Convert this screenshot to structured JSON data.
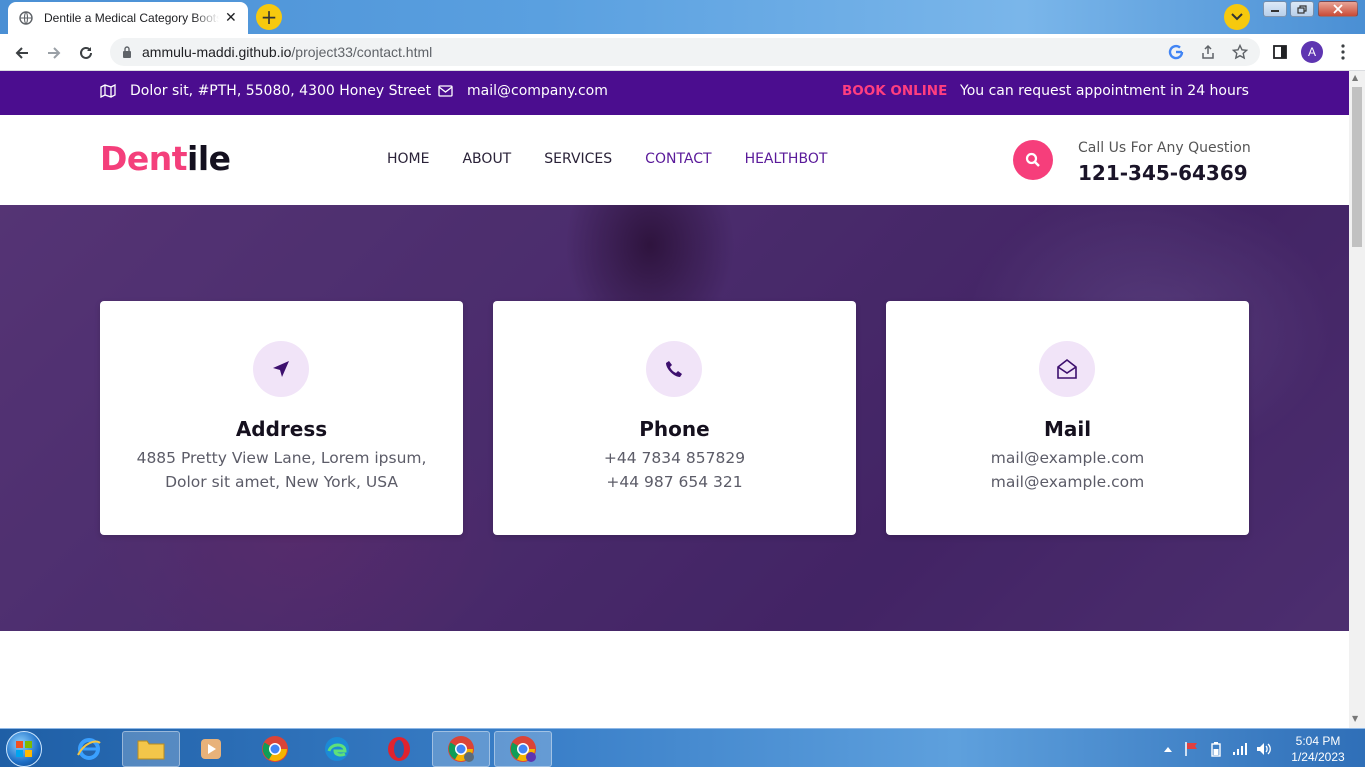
{
  "browser": {
    "tab_title": "Dentile a Medical Category Bootstrap",
    "tab_close": "✕",
    "new_tab": "+",
    "url_host": "ammulu-maddi.github.io",
    "url_path": "/project33/contact.html",
    "profile_initial": "A"
  },
  "topbar": {
    "address": "Dolor sit, #PTH, 55080, 4300 Honey Street",
    "email": "mail@company.com",
    "book_online": "BOOK ONLINE",
    "appointment_note": "You can request appointment in 24 hours"
  },
  "header": {
    "logo_part1": "Dent",
    "logo_part2": "ile",
    "nav": [
      "HOME",
      "ABOUT",
      "SERVICES",
      "CONTACT",
      "HEALTHBOT"
    ],
    "call_label": "Call Us For Any Question",
    "call_number": "121-345-64369"
  },
  "cards": [
    {
      "title": "Address",
      "lines": [
        "4885 Pretty View Lane, Lorem ipsum,",
        "Dolor sit amet, New York, USA"
      ],
      "icon": "location-arrow-icon"
    },
    {
      "title": "Phone",
      "lines": [
        "+44 7834 857829",
        "+44 987 654 321"
      ],
      "icon": "phone-icon"
    },
    {
      "title": "Mail",
      "lines": [
        "mail@example.com",
        "mail@example.com"
      ],
      "icon": "envelope-open-icon"
    }
  ],
  "taskbar": {
    "time": "5:04 PM",
    "date": "1/24/2023"
  },
  "colors": {
    "topbar": "#4b0d8f",
    "accent_pink": "#f63e7b",
    "nav_accent": "#5a1a9a",
    "icon_bg": "#f1e4f8"
  }
}
